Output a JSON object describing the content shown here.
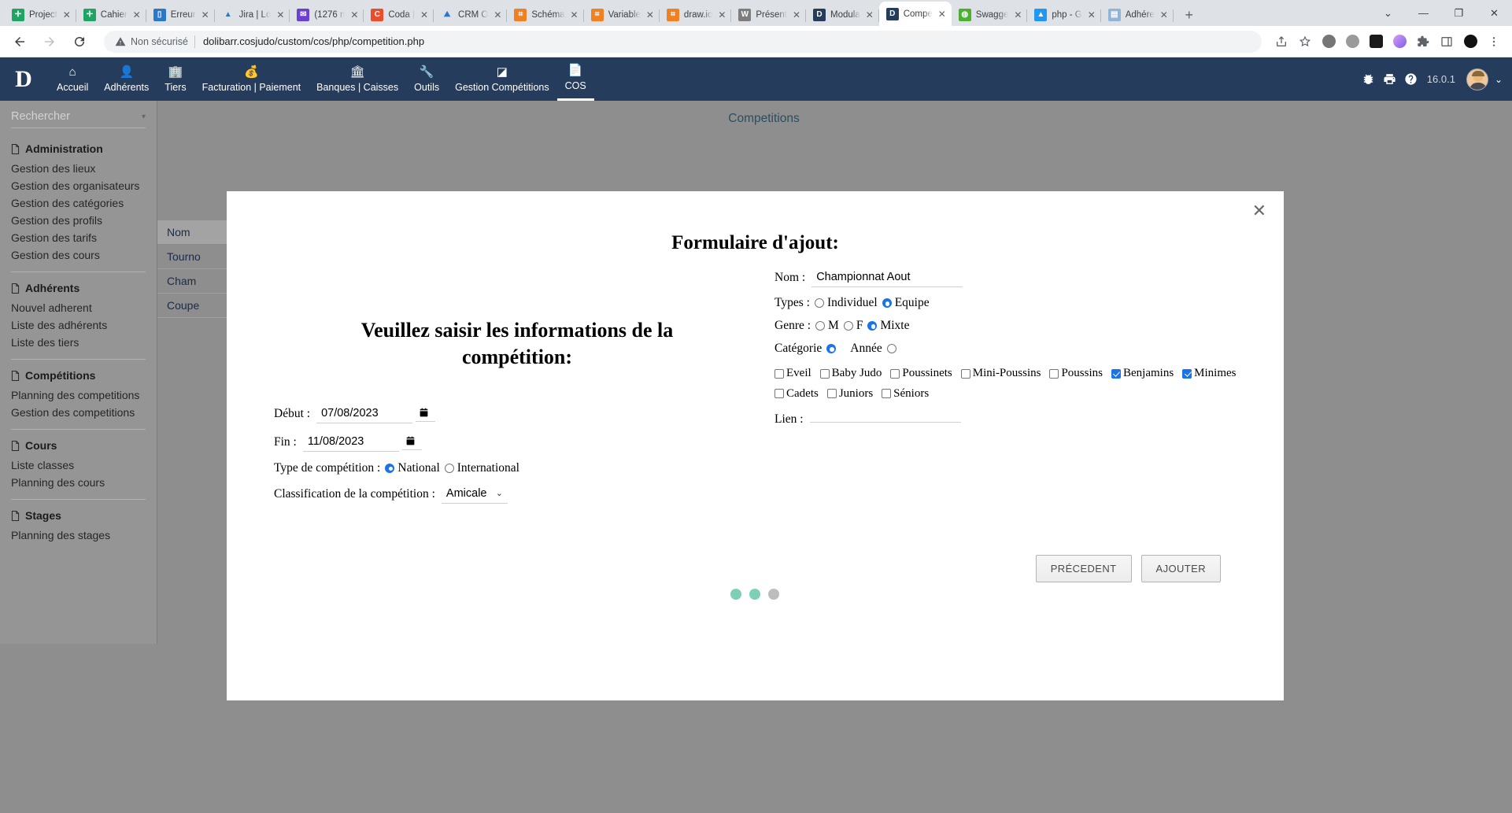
{
  "browser": {
    "tabs": [
      {
        "title": "Project",
        "favicon": "drive-green",
        "color": "#1fa463",
        "glyph": "✛"
      },
      {
        "title": "Cahier",
        "favicon": "drive-green",
        "color": "#1fa463",
        "glyph": "✛"
      },
      {
        "title": "Erreur",
        "favicon": "teams-blue",
        "color": "#2b77c9",
        "glyph": "▯"
      },
      {
        "title": "Jira | Lo",
        "favicon": "jira-blue",
        "color": "#ffffff",
        "glyph": "▲"
      },
      {
        "title": "(1276 n",
        "favicon": "mail-purple",
        "color": "#6b3fd4",
        "glyph": "✉"
      },
      {
        "title": "Coda |",
        "favicon": "coda-red",
        "color": "#ee4b2b",
        "glyph": "C"
      },
      {
        "title": "CRM O",
        "favicon": "crm-orange",
        "color": "#ffffff",
        "glyph": "⛰"
      },
      {
        "title": "Schéma",
        "favicon": "dia-orange",
        "color": "#f08020",
        "glyph": "⌗"
      },
      {
        "title": "Variable",
        "favicon": "dia-orange",
        "color": "#f08020",
        "glyph": "⌗"
      },
      {
        "title": "draw.io",
        "favicon": "dia-orange",
        "color": "#f08020",
        "glyph": "⌗"
      },
      {
        "title": "Présent",
        "favicon": "wordpress-gray",
        "color": "#7d7d7d",
        "glyph": "W"
      },
      {
        "title": "Modula",
        "favicon": "dolibarr-navy",
        "color": "#263c5c",
        "glyph": "D"
      },
      {
        "title": "Compe",
        "favicon": "dolibarr-navy",
        "color": "#263c5c",
        "glyph": "D",
        "active": true
      },
      {
        "title": "Swagge",
        "favicon": "swagger-green",
        "color": "#4caf32",
        "glyph": "◍"
      },
      {
        "title": "php - G",
        "favicon": "drive-triangle",
        "color": "#2196f3",
        "glyph": "▲"
      },
      {
        "title": "Adhére",
        "favicon": "sheet-blue",
        "color": "#90b4d8",
        "glyph": "▤"
      }
    ],
    "new_tab_label": "+",
    "close_label": "✕",
    "window_controls": {
      "restore_down": "⌄",
      "minimize": "—",
      "maximize": "❐",
      "close": "✕"
    },
    "nav": {
      "back": "←",
      "forward": "→",
      "reload": "⟳"
    },
    "omnibox": {
      "security_label": "Non sécurisé",
      "url": "dolibarr.cosjudo/custom/cos/php/competition.php"
    },
    "toolbar_icons": [
      "share-icon",
      "bookmark-star-icon",
      "pinterest-extension-icon",
      "adblock-extension-icon",
      "lion-extension-icon",
      "color-extension-icon",
      "puzzle-extensions-icon",
      "side-panel-icon",
      "dark-extension-icon",
      "chrome-menu-icon"
    ]
  },
  "app": {
    "logo": "D",
    "topmenu": [
      {
        "label": "Accueil",
        "icon": "home-icon",
        "glyph": "⌂"
      },
      {
        "label": "Adhérents",
        "icon": "user-icon",
        "glyph": "👤"
      },
      {
        "label": "Tiers",
        "icon": "building-icon",
        "glyph": "🏢"
      },
      {
        "label": "Facturation | Paiement",
        "icon": "invoice-icon",
        "glyph": "💰"
      },
      {
        "label": "Banques | Caisses",
        "icon": "bank-icon",
        "glyph": "🏛"
      },
      {
        "label": "Outils",
        "icon": "wrench-icon",
        "glyph": "🔧"
      },
      {
        "label": "Gestion Compétitions",
        "icon": "trophy-icon",
        "glyph": "◪"
      },
      {
        "label": "COS",
        "icon": "page-icon",
        "glyph": "📄",
        "selected": true
      }
    ],
    "topmenu_right": {
      "bug_icon": "bug-icon",
      "print_icon": "printer-icon",
      "help_icon": "help-icon",
      "version": "16.0.1",
      "user_caret": "⌄"
    }
  },
  "sidebar": {
    "search_placeholder": "Rechercher",
    "caret": "▾",
    "groups": [
      {
        "title": "Administration",
        "items": [
          "Gestion des lieux",
          "Gestion des organisateurs",
          "Gestion des catégories",
          "Gestion des profils",
          "Gestion des tarifs",
          "Gestion des cours"
        ]
      },
      {
        "title": "Adhérents",
        "items": [
          "Nouvel adherent",
          "Liste des adhérents",
          "Liste des tiers"
        ]
      },
      {
        "title": "Compétitions",
        "items": [
          "Planning des competitions",
          "Gestion des competitions"
        ]
      },
      {
        "title": "Cours",
        "items": [
          "Liste classes",
          "Planning des cours"
        ]
      },
      {
        "title": "Stages",
        "items": [
          "Planning des stages"
        ]
      }
    ]
  },
  "background": {
    "page_title": "Competitions",
    "table": {
      "header": "Nom",
      "rows": [
        "Tourno",
        "Cham",
        "Coupe"
      ]
    }
  },
  "modal": {
    "close_label": "✕",
    "title": "Formulaire d'ajout:",
    "left": {
      "heading": "Veuillez saisir les informations de la compétition:",
      "debut_label": "Début :",
      "debut_value": "07/08/2023",
      "fin_label": "Fin :",
      "fin_value": "11/08/2023",
      "type_label": "Type de compétition :",
      "type_options": [
        {
          "label": "National",
          "checked": true
        },
        {
          "label": "International",
          "checked": false
        }
      ],
      "classification_label": "Classification de la compétition :",
      "classification_value": "Amicale",
      "classification_caret": "⌄"
    },
    "right": {
      "nom_label": "Nom :",
      "nom_value": "Championnat Aout",
      "types_label": "Types :",
      "types_options": [
        {
          "label": "Individuel",
          "checked": false
        },
        {
          "label": "Equipe",
          "checked": true
        }
      ],
      "genre_label": "Genre :",
      "genre_options": [
        {
          "label": "M",
          "checked": false
        },
        {
          "label": "F",
          "checked": false
        },
        {
          "label": "Mixte",
          "checked": true
        }
      ],
      "categorie_label": "Catégorie",
      "categorie_checked": true,
      "annee_label": "Année",
      "annee_checked": false,
      "categories_row1": [
        {
          "label": "Eveil",
          "checked": false
        },
        {
          "label": "Baby Judo",
          "checked": false
        },
        {
          "label": "Poussinets",
          "checked": false
        },
        {
          "label": "Mini-Poussins",
          "checked": false
        },
        {
          "label": "Poussins",
          "checked": false
        },
        {
          "label": "Benjamins",
          "checked": true
        },
        {
          "label": "Minimes",
          "checked": true
        }
      ],
      "categories_row2": [
        {
          "label": "Cadets",
          "checked": false
        },
        {
          "label": "Juniors",
          "checked": false
        },
        {
          "label": "Séniors",
          "checked": false
        }
      ],
      "lien_label": "Lien :",
      "lien_value": ""
    },
    "buttons": {
      "previous": "PRÉCEDENT",
      "add": "AJOUTER"
    },
    "step_dots": [
      {
        "color": "#7dd0b6",
        "active": true
      },
      {
        "color": "#7dd0b6",
        "active": true
      },
      {
        "color": "#bdbdbd",
        "active": false
      }
    ]
  }
}
